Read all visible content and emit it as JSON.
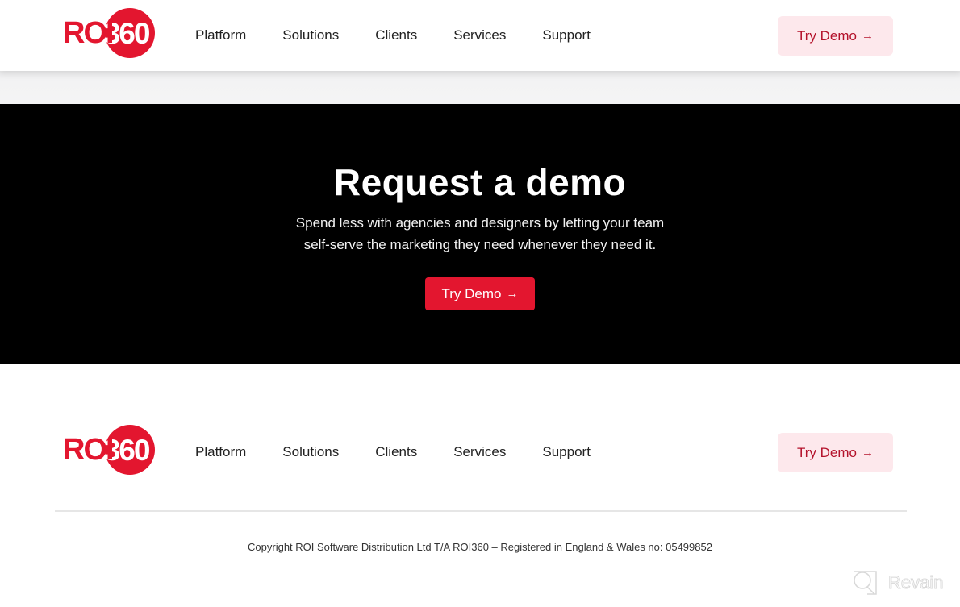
{
  "header": {
    "logo": {
      "text_left": "ROI",
      "text_right": "360"
    },
    "nav": [
      "Platform",
      "Solutions",
      "Clients",
      "Services",
      "Support"
    ],
    "cta_label": "Try Demo",
    "cta_icon": "arrow-right-icon"
  },
  "hero": {
    "title": "Request a demo",
    "subtitle_line1": "Spend less with agencies and designers by letting your team",
    "subtitle_line2": "self-serve the marketing they need whenever they need it.",
    "cta_label": "Try Demo",
    "cta_icon": "arrow-right-icon"
  },
  "footer": {
    "logo": {
      "text_left": "ROI",
      "text_right": "360"
    },
    "nav": [
      "Platform",
      "Solutions",
      "Clients",
      "Services",
      "Support"
    ],
    "cta_label": "Try Demo",
    "copyright": "Copyright ROI Software Distribution Ltd T/A ROI360 – Registered in England & Wales no: 05499852"
  },
  "watermark": {
    "text": "Revain",
    "icon": "revain-logo-icon"
  },
  "colors": {
    "brand_red": "#e3162f",
    "cta_light_bg": "#fde8ec",
    "cta_light_text": "#b4122b",
    "hero_bg": "#000000"
  }
}
